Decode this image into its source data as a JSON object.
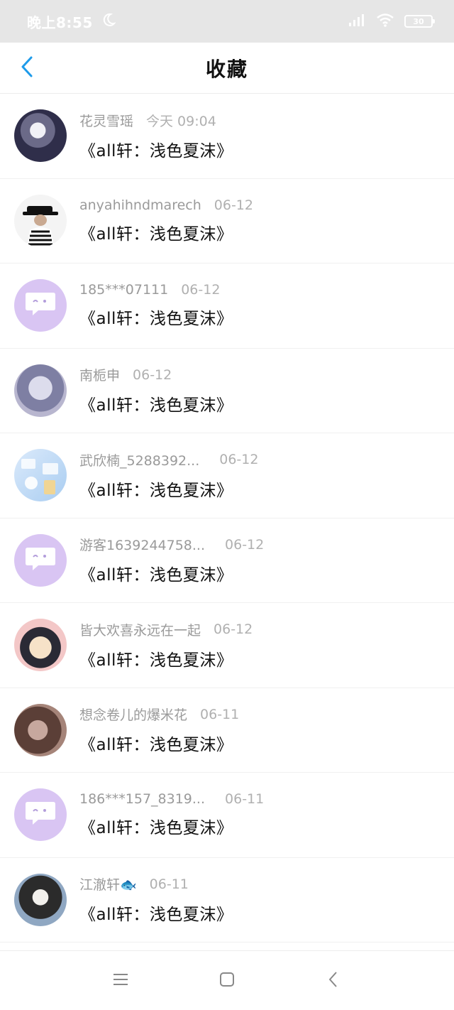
{
  "status_bar": {
    "time": "晚上8:55",
    "moon_icon": "moon-icon",
    "signal_icon": "signal-icon",
    "wifi_icon": "wifi-icon",
    "battery": "30"
  },
  "header": {
    "title": "收藏",
    "back_icon": "chevron-left-icon",
    "accent_color": "#1e9bea"
  },
  "favorites": [
    {
      "name": "花灵雪瑶",
      "date": "今天 09:04",
      "title": "《all轩：浅色夏沫》",
      "avatar": "avatar-anime-girl"
    },
    {
      "name": "anyahihndmarech",
      "date": "06-12",
      "title": "《all轩：浅色夏沫》",
      "avatar": "avatar-bucket-hat"
    },
    {
      "name": "185***07111",
      "date": "06-12",
      "title": "《all轩：浅色夏沫》",
      "avatar": "avatar-default-chat"
    },
    {
      "name": "南栀申",
      "date": "06-12",
      "title": "《all轩：浅色夏沫》",
      "avatar": "avatar-woman"
    },
    {
      "name": "武欣楠_5288392...",
      "date": "06-12",
      "title": "《all轩：浅色夏沫》",
      "avatar": "avatar-blue-pattern"
    },
    {
      "name": "游客1639244758...",
      "date": "06-12",
      "title": "《all轩：浅色夏沫》",
      "avatar": "avatar-default-chat"
    },
    {
      "name": "皆大欢喜永远在一起",
      "date": "06-12",
      "title": "《all轩：浅色夏沫》",
      "avatar": "avatar-anime-boy"
    },
    {
      "name": "想念卷儿的爆米花",
      "date": "06-11",
      "title": "《all轩：浅色夏沫》",
      "avatar": "avatar-brown-photo"
    },
    {
      "name": "186***157_8319...",
      "date": "06-11",
      "title": "《all轩：浅色夏沫》",
      "avatar": "avatar-default-chat"
    },
    {
      "name": "江澈轩🐟",
      "date": "06-11",
      "title": "《all轩：浅色夏沫》",
      "avatar": "avatar-man-photo"
    }
  ],
  "nav_bar": {
    "menu_icon": "menu-icon",
    "home_icon": "square-home-icon",
    "back_icon": "triangle-back-icon"
  }
}
